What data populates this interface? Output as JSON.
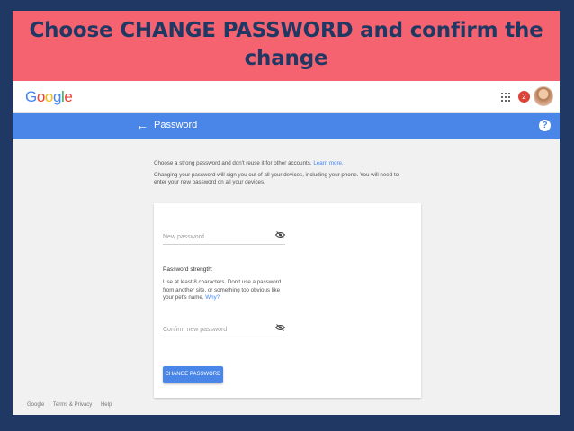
{
  "slide": {
    "title": "Choose CHANGE PASSWORD and confirm the change"
  },
  "topbar": {
    "logo": [
      "G",
      "o",
      "o",
      "g",
      "l",
      "e"
    ],
    "apps_icon": "apps-grid-icon",
    "notifications_count": "2",
    "avatar": "user-avatar"
  },
  "header": {
    "back_icon": "←",
    "title": "Password",
    "help_icon": "?"
  },
  "intro": {
    "line1": "Choose a strong password and don't reuse it for other accounts.",
    "learn_more": "Learn more.",
    "line2": "Changing your password will sign you out of all your devices, including your phone. You will need to enter your new password on all your devices."
  },
  "form": {
    "new_password_placeholder": "New password",
    "strength_title": "Password strength:",
    "strength_text": "Use at least 8 characters. Don't use a password from another site, or something too obvious like your pet's name.",
    "why_link": "Why?",
    "confirm_password_placeholder": "Confirm new password",
    "change_button": "CHANGE PASSWORD"
  },
  "footer": {
    "items": [
      "Google",
      "Terms & Privacy",
      "Help"
    ]
  },
  "colors": {
    "slide_bg": "#1f3864",
    "header_band": "#f4636f",
    "blue_bar": "#4a86e8",
    "link": "#4285f4"
  }
}
